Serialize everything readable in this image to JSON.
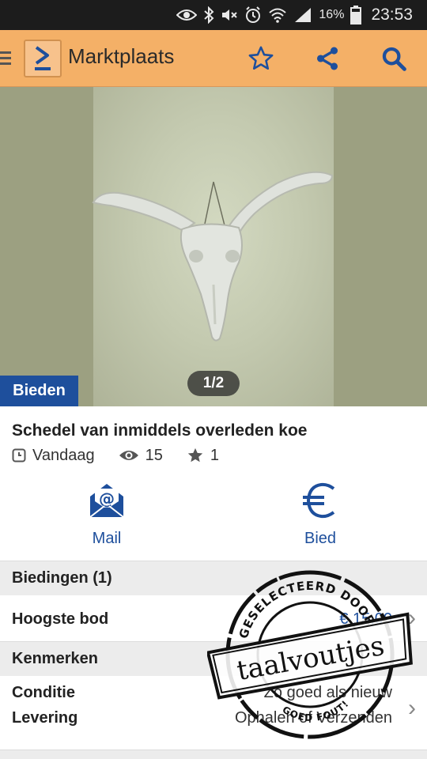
{
  "status_bar": {
    "battery_percent": "16%",
    "time": "23:53",
    "icons": [
      "eye-icon",
      "bluetooth-icon",
      "mute-icon",
      "alarm-icon",
      "wifi-icon",
      "signal-icon",
      "battery-icon"
    ]
  },
  "app_bar": {
    "title": "Marktplaats",
    "icons": [
      "menu-icon",
      "marktplaats-logo",
      "star-icon",
      "share-icon",
      "search-icon"
    ]
  },
  "photo": {
    "counter": "1/2",
    "bid_label": "Bieden"
  },
  "listing": {
    "title": "Schedel van inmiddels overleden koe",
    "date": "Vandaag",
    "views": "15",
    "favorites": "1"
  },
  "actions": {
    "mail_label": "Mail",
    "bid_label": "Bied"
  },
  "bids_section": {
    "header": "Biedingen (1)",
    "highest_label": "Hoogste bod",
    "highest_value": "€ 15,00"
  },
  "features_section": {
    "header": "Kenmerken",
    "condition_label": "Conditie",
    "condition_value": "Zo goed als nieuw",
    "delivery_label": "Levering",
    "delivery_value": "Ophalen of Verzenden"
  },
  "stamp": {
    "top_text": "GESELECTEERD DOOR",
    "brand": "taalvoutjes",
    "bottom_text": "GOED FOUT!"
  },
  "colors": {
    "app_bar": "#f4b067",
    "accent_blue": "#1e4f9c",
    "section_bg": "#ececec"
  }
}
